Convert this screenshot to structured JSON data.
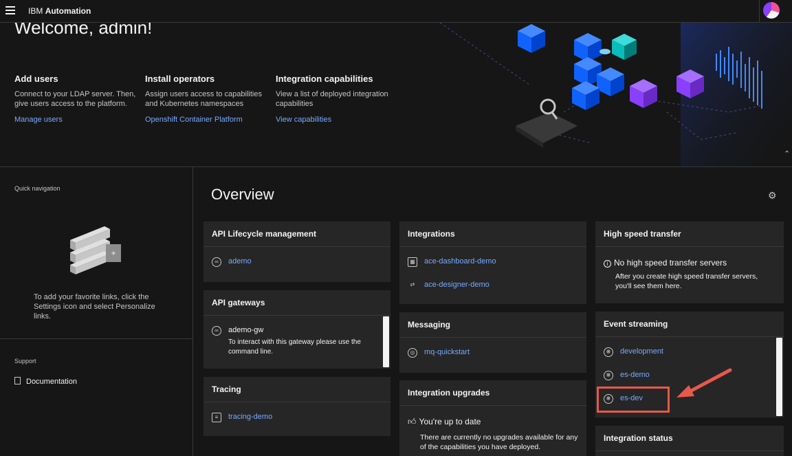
{
  "header": {
    "brand_prefix": "IBM",
    "brand_name": "Automation",
    "menu_icon": "menu-icon",
    "avatar_icon": "user-avatar"
  },
  "hero": {
    "welcome": "Welcome, admin!",
    "columns": [
      {
        "title": "Add users",
        "desc": "Connect to your LDAP server. Then, give users access to the platform.",
        "link": "Manage users"
      },
      {
        "title": "Install operators",
        "desc": "Assign users access to capabilities and Kubernetes namespaces",
        "link": "Openshift Container Platform"
      },
      {
        "title": "Integration capabilities",
        "desc": "View a list of deployed integration capabilities",
        "link": "View capabilities"
      }
    ]
  },
  "sidebar": {
    "quick_nav": "Quick navigation",
    "empty_text": "To add your favorite links, click the Settings icon and select Personalize links.",
    "support": "Support",
    "documentation": "Documentation"
  },
  "overview": {
    "title": "Overview"
  },
  "cards": {
    "api_lifecycle": {
      "title": "API Lifecycle management",
      "items": [
        "ademo"
      ]
    },
    "api_gateways": {
      "title": "API gateways",
      "gateway": "ademo-gw",
      "note": "To interact with this gateway please use the command line."
    },
    "tracing": {
      "title": "Tracing",
      "items": [
        "tracing-demo"
      ]
    },
    "integrations": {
      "title": "Integrations",
      "items": [
        "ace-dashboard-demo",
        "ace-designer-demo"
      ]
    },
    "messaging": {
      "title": "Messaging",
      "items": [
        "mq-quickstart"
      ]
    },
    "upgrades": {
      "title": "Integration upgrades",
      "status": "You're up to date",
      "note": "There are currently no upgrades available for any of the capabilities you have deployed."
    },
    "high_speed": {
      "title": "High speed transfer",
      "status": "No high speed transfer servers",
      "note": "After you create high speed transfer servers, you'll see them here."
    },
    "event_streaming": {
      "title": "Event streaming",
      "items": [
        "development",
        "es-demo",
        "es-dev"
      ]
    },
    "integration_status": {
      "title": "Integration status"
    }
  },
  "colors": {
    "accent_link": "#78a9ff",
    "highlight": "#e8584a",
    "bg": "#161616",
    "card": "#262626"
  }
}
